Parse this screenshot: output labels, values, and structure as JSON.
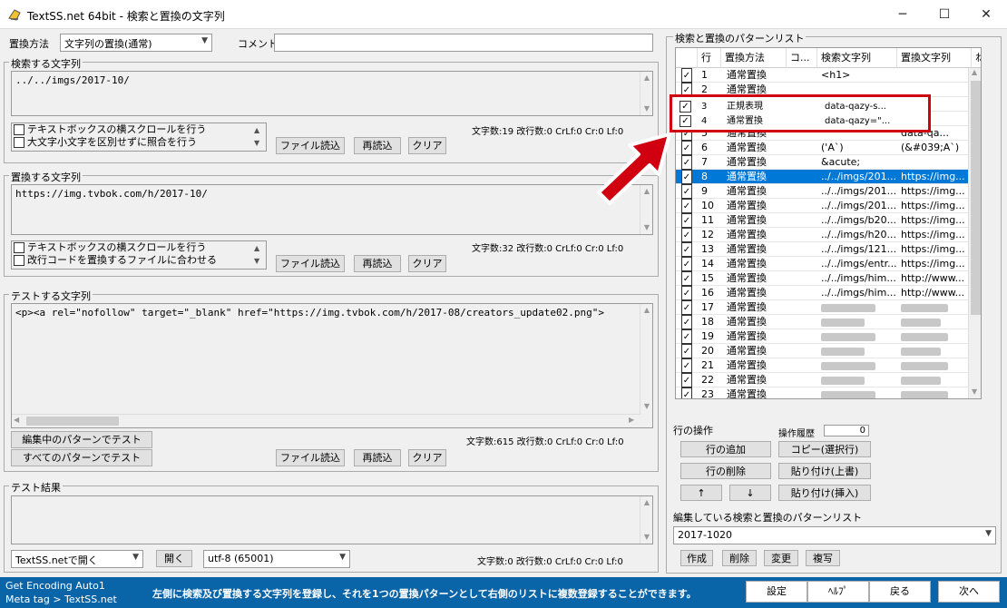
{
  "window": {
    "title": "TextSS.net 64bit - 検索と置換の文字列",
    "minimize": "─",
    "maximize": "☐",
    "close": "✕"
  },
  "top": {
    "method_label": "置換方法",
    "method_value": "文字列の置換(通常)",
    "comment_label": "コメント",
    "comment_value": ""
  },
  "search": {
    "group_label": "検索する文字列",
    "text": "../../imgs/2017-10/",
    "opt1": "テキストボックスの横スクロールを行う",
    "opt2": "大文字小文字を区別せずに照合を行う",
    "stats": "文字数:19  改行数:0  CrLf:0  Cr:0  Lf:0",
    "btn_load": "ファイル読込",
    "btn_reload": "再読込",
    "btn_clear": "クリア"
  },
  "replace": {
    "group_label": "置換する文字列",
    "text": "https://img.tvbok.com/h/2017-10/",
    "opt1": "テキストボックスの横スクロールを行う",
    "opt2": "改行コードを置換するファイルに合わせる",
    "stats": "文字数:32  改行数:0  CrLf:0  Cr:0  Lf:0",
    "btn_load": "ファイル読込",
    "btn_reload": "再読込",
    "btn_clear": "クリア"
  },
  "test": {
    "group_label": "テストする文字列",
    "text": "<p><a rel=\"nofollow\" target=\"_blank\" href=\"https://img.tvbok.com/h/2017-08/creators_update02.png\">",
    "btn_test_editing": "編集中のパターンでテスト",
    "btn_test_all": "すべてのパターンでテスト",
    "stats": "文字数:615  改行数:0  CrLf:0  Cr:0  Lf:0",
    "btn_load": "ファイル読込",
    "btn_reload": "再読込",
    "btn_clear": "クリア"
  },
  "result": {
    "group_label": "テスト結果",
    "open_with": "TextSS.netで開く",
    "btn_open": "開く",
    "encoding": "utf-8 (65001)",
    "stats": "文字数:0  改行数:0  CrLf:0  Cr:0  Lf:0"
  },
  "pattern_list": {
    "group_label": "検索と置換のパターンリスト",
    "headers": [
      "行",
      "置換方法",
      "コ...",
      "検索文字列",
      "置換文字列",
      "ね"
    ],
    "rows": [
      {
        "n": "1",
        "m": "通常置換",
        "s": "<h1>",
        "r": "",
        "sel": false
      },
      {
        "n": "2",
        "m": "通常置換",
        "s": "",
        "r": "",
        "sel": false
      },
      {
        "n": "3",
        "m": "正規表現",
        "s": "data-qazy-s...",
        "r": "",
        "sel": false
      },
      {
        "n": "4",
        "m": "通常置換",
        "s": "data-qazy=\"...",
        "r": "",
        "sel": false
      },
      {
        "n": "5",
        "m": "通常置換",
        "s": "",
        "r": "data-qa...",
        "sel": false
      },
      {
        "n": "6",
        "m": "通常置換",
        "s": "('A`)",
        "r": "(&#039;A`)",
        "sel": false
      },
      {
        "n": "7",
        "m": "通常置換",
        "s": "&acute;",
        "r": "",
        "sel": false
      },
      {
        "n": "8",
        "m": "通常置換",
        "s": "../../imgs/201...",
        "r": "https://img...",
        "sel": true
      },
      {
        "n": "9",
        "m": "通常置換",
        "s": "../../imgs/201...",
        "r": "https://img...",
        "sel": false
      },
      {
        "n": "10",
        "m": "通常置換",
        "s": "../../imgs/201...",
        "r": "https://img...",
        "sel": false
      },
      {
        "n": "11",
        "m": "通常置換",
        "s": "../../imgs/b20...",
        "r": "https://img...",
        "sel": false
      },
      {
        "n": "12",
        "m": "通常置換",
        "s": "../../imgs/h20...",
        "r": "https://img...",
        "sel": false
      },
      {
        "n": "13",
        "m": "通常置換",
        "s": "../../imgs/121...",
        "r": "https://img...",
        "sel": false
      },
      {
        "n": "14",
        "m": "通常置換",
        "s": "../../imgs/entr...",
        "r": "https://img...",
        "sel": false
      },
      {
        "n": "15",
        "m": "通常置換",
        "s": "../../imgs/him...",
        "r": "http://www...",
        "sel": false
      },
      {
        "n": "16",
        "m": "通常置換",
        "s": "../../imgs/him...",
        "r": "http://www...",
        "sel": false
      },
      {
        "n": "17",
        "m": "通常置換",
        "s": "",
        "r": "",
        "sel": false
      },
      {
        "n": "18",
        "m": "通常置換",
        "s": "",
        "r": "",
        "sel": false
      },
      {
        "n": "19",
        "m": "通常置換",
        "s": "",
        "r": "",
        "sel": false
      },
      {
        "n": "20",
        "m": "通常置換",
        "s": "",
        "r": "",
        "sel": false
      },
      {
        "n": "21",
        "m": "通常置換",
        "s": "",
        "r": "",
        "sel": false
      },
      {
        "n": "22",
        "m": "通常置換",
        "s": "",
        "r": "",
        "sel": false
      },
      {
        "n": "23",
        "m": "通常置換",
        "s": "",
        "r": "",
        "sel": false
      }
    ],
    "callout_rows": [
      {
        "n": "3",
        "m": "正規表現",
        "s": "data-qazy-s..."
      },
      {
        "n": "4",
        "m": "通常置換",
        "s": "data-qazy=\"..."
      }
    ]
  },
  "row_ops": {
    "label": "行の操作",
    "history_label": "操作履歴",
    "history_value": "0",
    "btn_add": "行の追加",
    "btn_copy": "コピー(選択行)",
    "btn_delete": "行の削除",
    "btn_paste_over": "貼り付け(上書)",
    "btn_up": "↑",
    "btn_down": "↓",
    "btn_paste_insert": "貼り付け(挿入)"
  },
  "editing": {
    "label": "編集している検索と置換のパターンリスト",
    "value": "2017-1020",
    "btn_create": "作成",
    "btn_delete": "削除",
    "btn_change": "変更",
    "btn_duplicate": "複写"
  },
  "status": {
    "line1": "Get Encoding Auto1",
    "line2": "Meta tag > TextSS.net",
    "message": "左側に検索及び置換する文字列を登録し、それを1つの置換パターンとして右側のリストに複数登録することができます。",
    "btn_settings": "設定",
    "btn_help": "ﾍﾙﾌﾟ",
    "btn_back": "戻る",
    "btn_next": "次へ"
  },
  "colors": {
    "selection": "#0078d7",
    "callout": "#d00010",
    "statusbar": "#0a64a8"
  }
}
